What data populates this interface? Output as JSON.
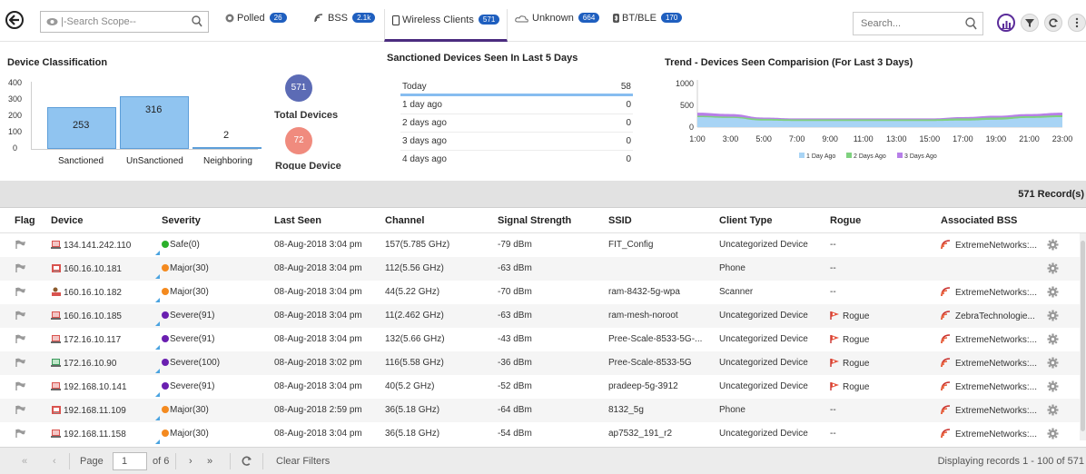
{
  "header": {
    "scope_placeholder": "|-Search Scope--",
    "search_placeholder": "Search...",
    "tabs": [
      {
        "label": "Polled",
        "count": "26"
      },
      {
        "label": "BSS",
        "count": "2.1k"
      },
      {
        "label": "Wireless Clients",
        "count": "571"
      },
      {
        "label": "Unknown",
        "count": "664"
      },
      {
        "label": "BT/BLE",
        "count": "170"
      }
    ]
  },
  "classification": {
    "title": "Device Classification",
    "y_ticks": [
      "400",
      "300",
      "200",
      "100",
      "0"
    ],
    "bars": [
      {
        "label": "Sanctioned",
        "value": "253"
      },
      {
        "label": "UnSanctioned",
        "value": "316"
      },
      {
        "label": "Neighboring",
        "value": "2"
      }
    ],
    "total_count": "571",
    "total_label": "Total Devices",
    "rogue_count": "72",
    "rogue_label": "Rogue Device"
  },
  "sanctioned": {
    "title": "Sanctioned Devices Seen In Last 5 Days",
    "rows": [
      {
        "label": "Today",
        "value": "58"
      },
      {
        "label": "1 day ago",
        "value": "0"
      },
      {
        "label": "2 days ago",
        "value": "0"
      },
      {
        "label": "3 days ago",
        "value": "0"
      },
      {
        "label": "4 days ago",
        "value": "0"
      }
    ]
  },
  "chart_data": {
    "type": "area",
    "title": "Trend - Devices Seen Comparision (For Last 3 Days)",
    "x": [
      "1:00",
      "3:00",
      "5:00",
      "7:00",
      "9:00",
      "11:00",
      "13:00",
      "15:00",
      "17:00",
      "19:00",
      "21:00",
      "23:00"
    ],
    "y_ticks": [
      "1000",
      "500",
      "0"
    ],
    "ylim": [
      0,
      1000
    ],
    "series": [
      {
        "name": "1 Day Ago",
        "color": "#a8d4f5",
        "values": [
          230,
          210,
          150,
          140,
          140,
          140,
          140,
          140,
          150,
          170,
          210,
          230
        ]
      },
      {
        "name": "2 Days Ago",
        "color": "#7fd17f",
        "values": [
          260,
          240,
          190,
          180,
          180,
          180,
          180,
          180,
          200,
          220,
          250,
          270
        ]
      },
      {
        "name": "3 Days Ago",
        "color": "#b77fe8",
        "values": [
          330,
          300,
          220,
          200,
          200,
          200,
          200,
          200,
          230,
          260,
          300,
          330
        ]
      }
    ],
    "legend_position": "bottom"
  },
  "records": {
    "label": "571 Record(s)"
  },
  "table": {
    "columns": [
      "Flag",
      "Device",
      "Severity",
      "Last Seen",
      "Channel",
      "Signal Strength",
      "SSID",
      "Client Type",
      "Rogue",
      "Associated BSS"
    ],
    "rows": [
      {
        "device": "134.141.242.110",
        "device_icon": "laptop",
        "severity": "Safe(0)",
        "sev_color": "#2bb02b",
        "last_seen": "08-Aug-2018 3:04 pm",
        "channel": "157(5.785 GHz)",
        "signal": "-79 dBm",
        "ssid": "FIT_Config",
        "client_type": "Uncategorized Device",
        "rogue": "--",
        "rogue_flag": false,
        "bss": "ExtremeNetworks:..."
      },
      {
        "device": "160.16.10.181",
        "device_icon": "phone",
        "severity": "Major(30)",
        "sev_color": "#f48a1f",
        "last_seen": "08-Aug-2018 3:04 pm",
        "channel": "112(5.56 GHz)",
        "signal": "-63 dBm",
        "ssid": "",
        "client_type": "Phone",
        "rogue": "--",
        "rogue_flag": false,
        "bss": ""
      },
      {
        "device": "160.16.10.182",
        "device_icon": "scanner",
        "severity": "Major(30)",
        "sev_color": "#f48a1f",
        "last_seen": "08-Aug-2018 3:04 pm",
        "channel": "44(5.22 GHz)",
        "signal": "-70 dBm",
        "ssid": "ram-8432-5g-wpa",
        "client_type": "Scanner",
        "rogue": "--",
        "rogue_flag": false,
        "bss": "ExtremeNetworks:..."
      },
      {
        "device": "160.16.10.185",
        "device_icon": "laptop",
        "severity": "Severe(91)",
        "sev_color": "#6a1fb0",
        "last_seen": "08-Aug-2018 3:04 pm",
        "channel": "11(2.462 GHz)",
        "signal": "-63 dBm",
        "ssid": "ram-mesh-noroot",
        "client_type": "Uncategorized Device",
        "rogue": "Rogue",
        "rogue_flag": true,
        "bss": "ZebraTechnologie..."
      },
      {
        "device": "172.16.10.117",
        "device_icon": "laptop",
        "severity": "Severe(91)",
        "sev_color": "#6a1fb0",
        "last_seen": "08-Aug-2018 3:04 pm",
        "channel": "132(5.66 GHz)",
        "signal": "-43 dBm",
        "ssid": "Pree-Scale-8533-5G-...",
        "client_type": "Uncategorized Device",
        "rogue": "Rogue",
        "rogue_flag": true,
        "bss": "ExtremeNetworks:..."
      },
      {
        "device": "172.16.10.90",
        "device_icon": "laptop-green",
        "severity": "Severe(100)",
        "sev_color": "#6a1fb0",
        "last_seen": "08-Aug-2018 3:02 pm",
        "channel": "116(5.58 GHz)",
        "signal": "-36 dBm",
        "ssid": "Pree-Scale-8533-5G",
        "client_type": "Uncategorized Device",
        "rogue": "Rogue",
        "rogue_flag": true,
        "bss": "ExtremeNetworks:..."
      },
      {
        "device": "192.168.10.141",
        "device_icon": "laptop",
        "severity": "Severe(91)",
        "sev_color": "#6a1fb0",
        "last_seen": "08-Aug-2018 3:04 pm",
        "channel": "40(5.2 GHz)",
        "signal": "-52 dBm",
        "ssid": "pradeep-5g-3912",
        "client_type": "Uncategorized Device",
        "rogue": "Rogue",
        "rogue_flag": true,
        "bss": "ExtremeNetworks:..."
      },
      {
        "device": "192.168.11.109",
        "device_icon": "phone",
        "severity": "Major(30)",
        "sev_color": "#f48a1f",
        "last_seen": "08-Aug-2018 2:59 pm",
        "channel": "36(5.18 GHz)",
        "signal": "-64 dBm",
        "ssid": "8132_5g",
        "client_type": "Phone",
        "rogue": "--",
        "rogue_flag": false,
        "bss": "ExtremeNetworks:..."
      },
      {
        "device": "192.168.11.158",
        "device_icon": "laptop",
        "severity": "Major(30)",
        "sev_color": "#f48a1f",
        "last_seen": "08-Aug-2018 3:04 pm",
        "channel": "36(5.18 GHz)",
        "signal": "-54 dBm",
        "ssid": "ap7532_191_r2",
        "client_type": "Uncategorized Device",
        "rogue": "--",
        "rogue_flag": false,
        "bss": "ExtremeNetworks:..."
      }
    ]
  },
  "footer": {
    "page_label": "Page",
    "page_value": "1",
    "of_label": "of 6",
    "clear_filters": "Clear Filters",
    "display_text": "Displaying records 1 - 100 of 571"
  },
  "colors": {
    "accent": "#4b2c7f",
    "badge": "#1f5fbf",
    "bar_fill": "#90c4f0"
  }
}
